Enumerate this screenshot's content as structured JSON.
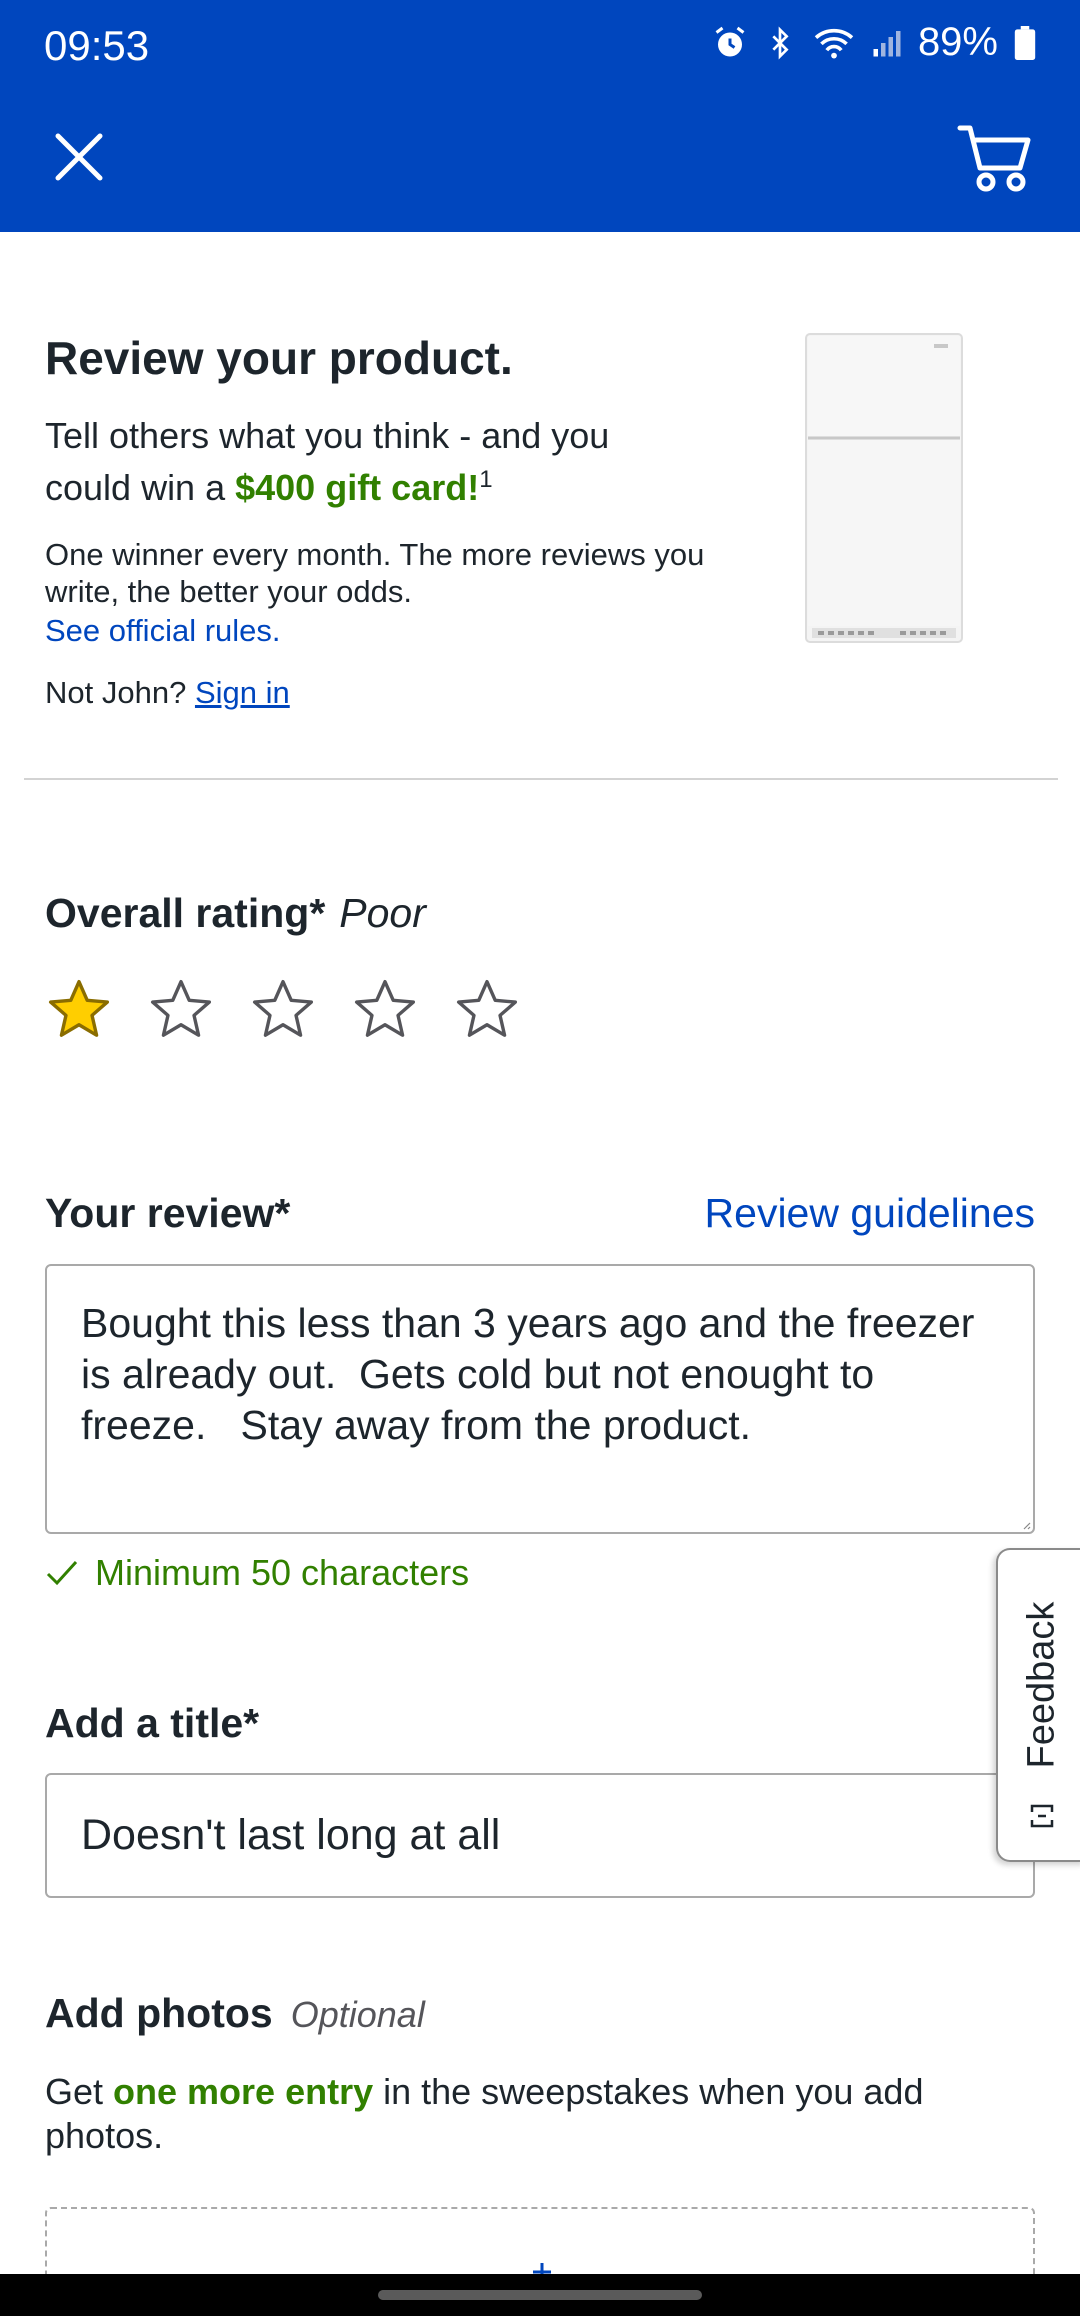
{
  "status_bar": {
    "time": "09:53",
    "battery": "89%",
    "icons": [
      "alarm-icon",
      "bluetooth-icon",
      "wifi-icon",
      "signal-icon",
      "battery-icon"
    ]
  },
  "toolbar": {
    "close_icon": "close-icon",
    "cart_icon": "cart-icon"
  },
  "intro": {
    "heading": "Review your product.",
    "lead_prefix": "Tell others what you think - and you could win a ",
    "lead_highlight": "$400 gift card!",
    "lead_sup": "1",
    "small_text": "One winner every month. The more reviews you write, the better your odds.",
    "rules_link": "See official rules.",
    "not_user": "Not John?",
    "sign_in": "Sign in"
  },
  "rating": {
    "title": "Overall rating*",
    "value_label": "Poor",
    "stars_filled": 1,
    "stars_total": 5
  },
  "review": {
    "label": "Your review*",
    "guidelines_link": "Review guidelines",
    "text": "Bought this less than 3 years ago and the freezer is already out.  Gets cold but not enought to freeze.   Stay away from the product.",
    "min_chars_note": "Minimum 50 characters"
  },
  "title_field": {
    "label": "Add a title*",
    "value": "Doesn't last long at all"
  },
  "photos": {
    "label": "Add photos",
    "optional": "Optional",
    "desc_prefix": "Get ",
    "desc_highlight": "one more entry",
    "desc_suffix": " in the sweepstakes when you add photos."
  },
  "feedback": {
    "label": "Feedback"
  },
  "colors": {
    "header_blue": "#0046be",
    "link_blue": "#0046be",
    "success_green": "#318000",
    "star_yellow": "#ffce00"
  }
}
